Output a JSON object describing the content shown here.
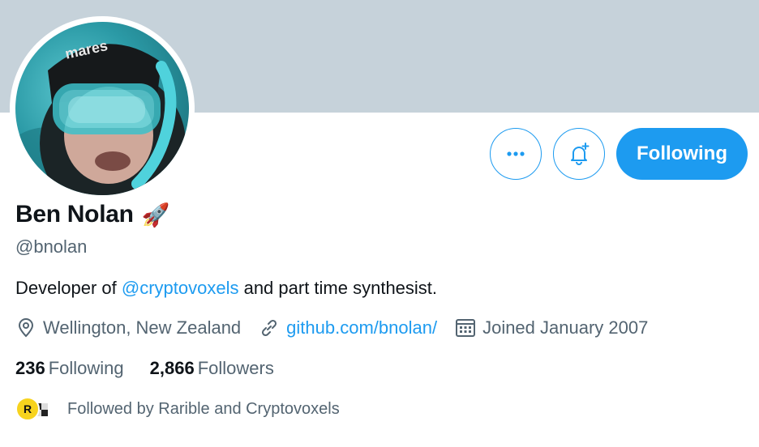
{
  "profile": {
    "name": "Ben Nolan",
    "emoji": "🚀",
    "handle": "@bnolan",
    "bio_prefix": "Developer of ",
    "bio_mention": "@cryptovoxels",
    "bio_suffix": " and part time synthesist.",
    "location": "Wellington, New Zealand",
    "website": "github.com/bnolan/",
    "joined": "Joined January 2007"
  },
  "stats": {
    "following_count": "236",
    "following_label": "Following",
    "followers_count": "2,866",
    "followers_label": "Followers"
  },
  "followed_by": {
    "text": "Followed by Rarible and Cryptovoxels",
    "rarible_initial": "R"
  },
  "actions": {
    "more_icon": "more-icon",
    "notify_icon": "bell-plus-icon",
    "follow_label": "Following"
  },
  "colors": {
    "accent": "#1d9bf0",
    "banner": "#c6d2da",
    "secondary_text": "#536471"
  }
}
